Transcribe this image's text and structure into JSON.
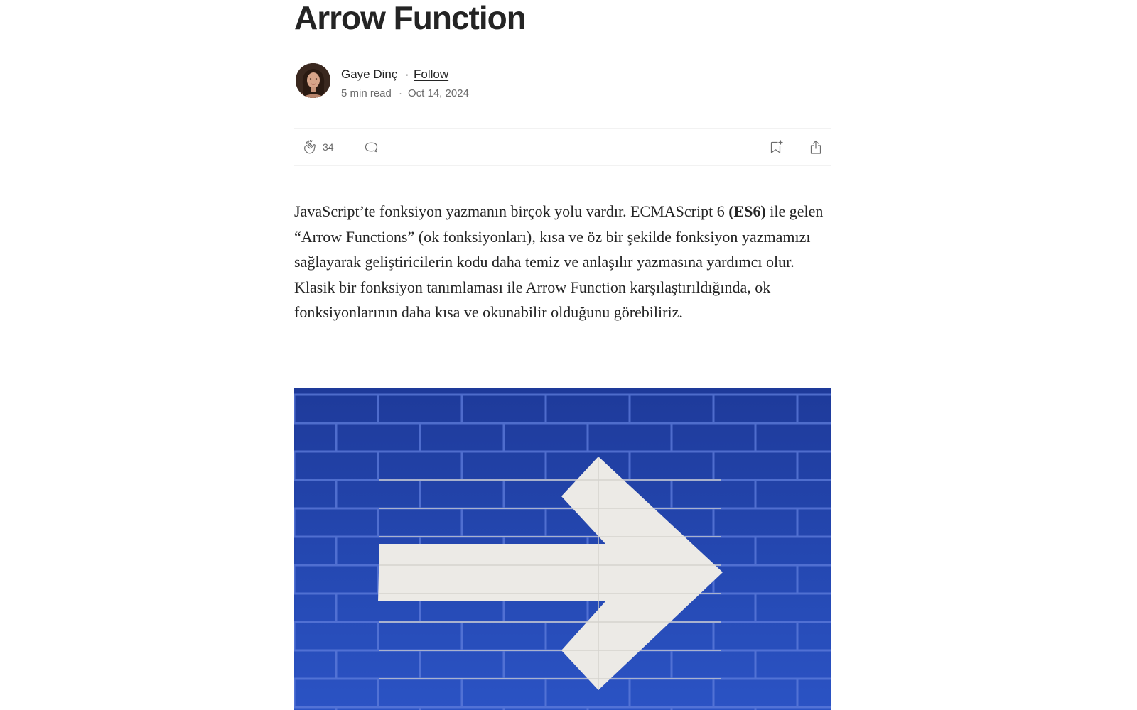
{
  "article": {
    "title": "Arrow Function",
    "author": {
      "name": "Gaye Dinç",
      "follow_label": "Follow",
      "read_time": "5 min read",
      "date": "Oct 14, 2024",
      "separator": "·"
    },
    "actions": {
      "clap_count": "34",
      "clap_icon": "clap-icon",
      "comment_icon": "comment-icon",
      "bookmark_icon": "bookmark-add-icon",
      "share_icon": "share-icon"
    },
    "body": {
      "part1": "JavaScript’te fonksiyon yazmanın birçok yolu vardır. ECMAScript 6 ",
      "bold": "(ES6)",
      "part2": " ile gelen “Arrow Functions” (ok fonksiyonları), kısa ve öz bir şekilde fonksiyon yazmamızı sağlayarak geliştiricilerin kodu daha temiz ve anlaşılır yazmasına yardımcı olur. Klasik bir fonksiyon tanımlaması ile Arrow Function karşılaştırıldığında, ok fonksiyonlarının daha kısa ve okunabilir olduğunu görebiliriz."
    },
    "hero_image": {
      "description_icon": "white-arrow-on-blue-brick-wall-image",
      "colors": {
        "wall": "#2342a6",
        "mortar": "#5a78d6",
        "arrow": "#ecebe8"
      }
    }
  }
}
